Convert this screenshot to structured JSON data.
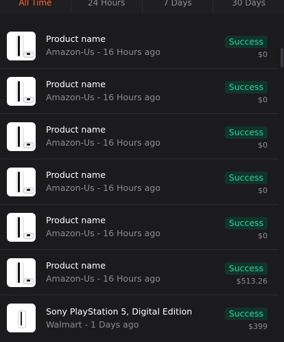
{
  "tabs": [
    {
      "label": "All Time",
      "active": true
    },
    {
      "label": "24 Hours",
      "active": false
    },
    {
      "label": "7 Days",
      "active": false
    },
    {
      "label": "30 Days",
      "active": false
    }
  ],
  "items": [
    {
      "title": "Product name",
      "subtitle": "Amazon-Us - 16 Hours ago",
      "status": "Success",
      "price": "$0",
      "image": "ps5-disc-icon"
    },
    {
      "title": "Product name",
      "subtitle": "Amazon-Us - 16 Hours ago",
      "status": "Success",
      "price": "$0",
      "image": "ps5-disc-icon"
    },
    {
      "title": "Product name",
      "subtitle": "Amazon-Us - 16 Hours ago",
      "status": "Success",
      "price": "$0",
      "image": "ps5-disc-icon"
    },
    {
      "title": "Product name",
      "subtitle": "Amazon-Us - 16 Hours ago",
      "status": "Success",
      "price": "$0",
      "image": "ps5-disc-icon"
    },
    {
      "title": "Product name",
      "subtitle": "Amazon-Us - 16 Hours ago",
      "status": "Success",
      "price": "$0",
      "image": "ps5-disc-icon"
    },
    {
      "title": "Product name",
      "subtitle": "Amazon-Us - 16 Hours ago",
      "status": "Success",
      "price": "$513.26",
      "image": "ps5-disc-icon"
    },
    {
      "title": "Sony PlayStation 5, Digital Edition",
      "subtitle": "Walmart - 1 Days ago",
      "status": "Success",
      "price": "$399",
      "image": "ps5-digital-icon"
    }
  ],
  "colors": {
    "background": "#1b1b1e",
    "accent": "#ff6a26",
    "success_text": "#2ed49a",
    "success_bg": "#11342b"
  }
}
